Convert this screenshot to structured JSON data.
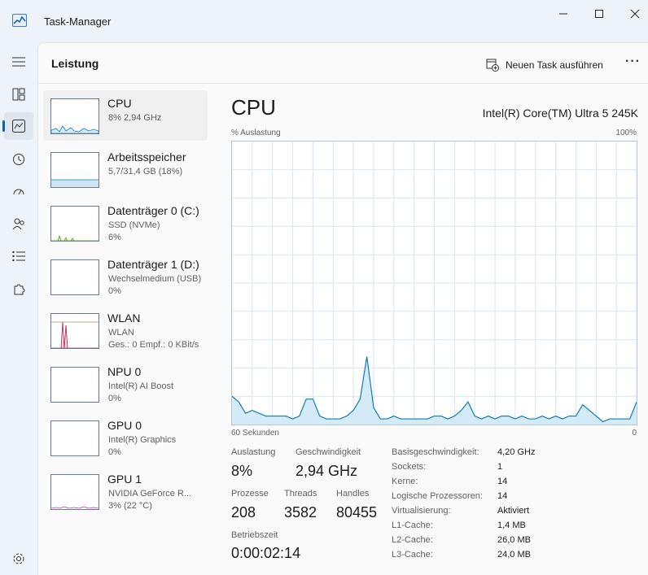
{
  "window": {
    "title": "Task-Manager"
  },
  "header": {
    "title": "Leistung",
    "new_task": "Neuen Task ausführen",
    "more": "···"
  },
  "perf_items": [
    {
      "name": "CPU",
      "line1": "8% 2,94 GHz",
      "line2": ""
    },
    {
      "name": "Arbeitsspeicher",
      "line1": "5,7/31,4 GB (18%)",
      "line2": ""
    },
    {
      "name": "Datenträger 0 (C:)",
      "line1": "SSD (NVMe)",
      "line2": "6%"
    },
    {
      "name": "Datenträger 1 (D:)",
      "line1": "Wechselmedium (USB)",
      "line2": "0%"
    },
    {
      "name": "WLAN",
      "line1": "WLAN",
      "line2": "Ges.: 0 Empf.: 0 KBit/s"
    },
    {
      "name": "NPU 0",
      "line1": "Intel(R) AI Boost",
      "line2": "0%"
    },
    {
      "name": "GPU 0",
      "line1": "Intel(R) Graphics",
      "line2": "0%"
    },
    {
      "name": "GPU 1",
      "line1": "NVIDIA GeForce R...",
      "line2": "3% (22 °C)"
    }
  ],
  "detail": {
    "title": "CPU",
    "model": "Intel(R) Core(TM) Ultra 5 245K",
    "graph_label": "% Auslastung",
    "graph_max": "100%",
    "graph_time": "60 Sekunden",
    "graph_min": "0",
    "stats": {
      "utilization_label": "Auslastung",
      "utilization": "8%",
      "speed_label": "Geschwindigkeit",
      "speed": "2,94 GHz",
      "processes_label": "Prozesse",
      "processes": "208",
      "threads_label": "Threads",
      "threads": "3582",
      "handles_label": "Handles",
      "handles": "80455",
      "uptime_label": "Betriebszeit",
      "uptime": "0:00:02:14"
    },
    "specs": [
      {
        "label": "Basisgeschwindigkeit:",
        "value": "4,20 GHz"
      },
      {
        "label": "Sockets:",
        "value": "1"
      },
      {
        "label": "Kerne:",
        "value": "14"
      },
      {
        "label": "Logische Prozessoren:",
        "value": "14"
      },
      {
        "label": "Virtualisierung:",
        "value": "Aktiviert"
      },
      {
        "label": "L1-Cache:",
        "value": "1,4 MB"
      },
      {
        "label": "L2-Cache:",
        "value": "26,0 MB"
      },
      {
        "label": "L3-Cache:",
        "value": "24,0 MB"
      }
    ]
  },
  "chart_data": {
    "type": "area",
    "ylim": [
      0,
      100
    ],
    "xlim": [
      60,
      0
    ],
    "x": [
      60,
      59,
      58,
      57,
      56,
      55,
      54,
      53,
      52,
      51,
      50,
      49,
      48,
      47,
      46,
      45,
      44,
      43,
      42,
      41,
      40,
      39,
      38,
      37,
      36,
      35,
      34,
      33,
      32,
      31,
      30,
      29,
      28,
      27,
      26,
      25,
      24,
      23,
      22,
      21,
      20,
      19,
      18,
      17,
      16,
      15,
      14,
      13,
      12,
      11,
      10,
      9,
      8,
      7,
      6,
      5,
      4,
      3,
      2,
      1,
      0
    ],
    "values": [
      10,
      8,
      4,
      5,
      4,
      3,
      3,
      3,
      3,
      2,
      3,
      9,
      9,
      3,
      2,
      2,
      2,
      3,
      5,
      9,
      24,
      6,
      2,
      2,
      3,
      2,
      2,
      2,
      2,
      2,
      3,
      3,
      2,
      3,
      5,
      8,
      3,
      2,
      3,
      2,
      3,
      3,
      2,
      3,
      2,
      2,
      3,
      2,
      3,
      2,
      3,
      3,
      7,
      5,
      3,
      1,
      2,
      2,
      2,
      2,
      8
    ],
    "colors": {
      "line": "#117dbb",
      "fill": "#d4eaf7",
      "grid": "#d9e5ef"
    },
    "grid": true
  },
  "thumb_colors": {
    "cpu": "#117dbb",
    "memory": "#8a2be2",
    "disk": "#4da60c",
    "wlan": "#a74f01",
    "gpu": "#a83ab3"
  }
}
